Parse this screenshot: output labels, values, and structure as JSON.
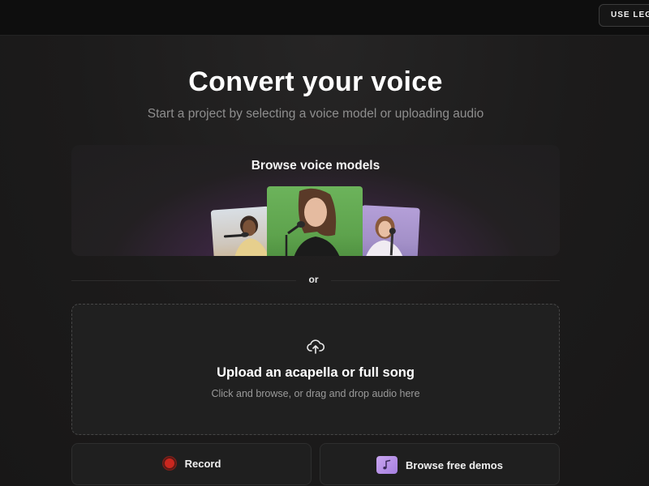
{
  "header": {
    "legacy_button_label": "USE LEGACY"
  },
  "hero": {
    "title": "Convert your voice",
    "subtitle": "Start a project by selecting a voice model or uploading audio"
  },
  "browse": {
    "title": "Browse voice models"
  },
  "separator": {
    "label": "or"
  },
  "upload": {
    "icon": "cloud-upload-icon",
    "title": "Upload an acapella or full song",
    "subtitle": "Click and browse, or drag and drop audio here"
  },
  "actions": {
    "record_label": "Record",
    "record_icon": "record-icon",
    "demos_label": "Browse free demos",
    "demos_icon": "music-note-icon"
  },
  "colors": {
    "record_red": "#c9271f",
    "demo_purple": "#b892ea",
    "background": "#1a1919"
  }
}
